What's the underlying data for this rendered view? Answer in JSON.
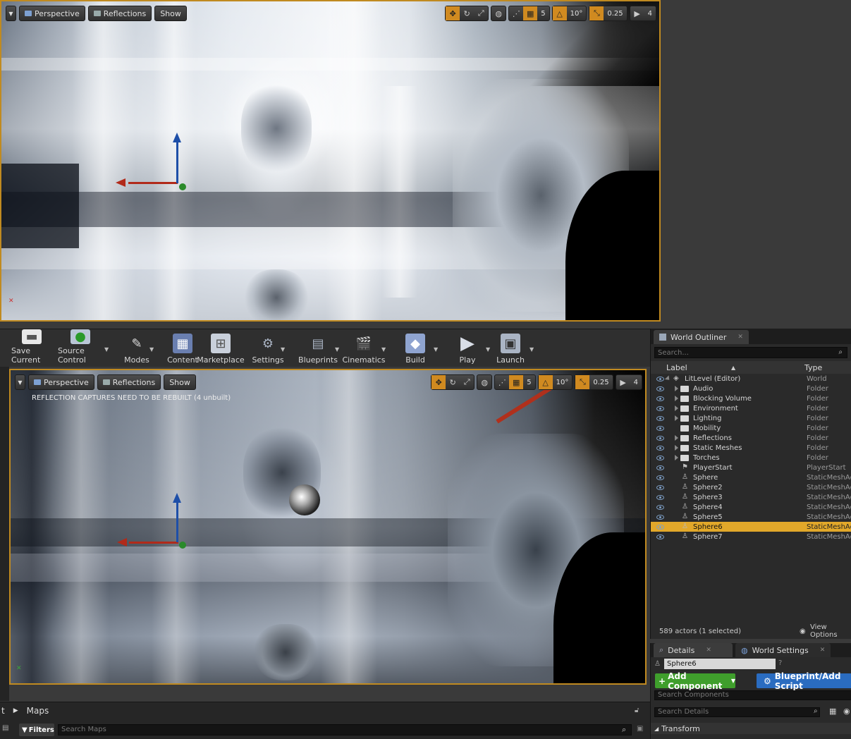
{
  "top_viewport": {
    "mode_label": "Perspective",
    "view_label": "Reflections",
    "show_label": "Show",
    "grid_snap": "5",
    "rotation_snap": "10°",
    "scale_snap": "0.25",
    "camera_speed": "4"
  },
  "toolbar": {
    "items": [
      {
        "label": "Save Current",
        "icon": "save-icon"
      },
      {
        "label": "Source Control",
        "icon": "source-control-icon"
      },
      {
        "label": "Modes",
        "icon": "modes-icon"
      },
      {
        "label": "Content",
        "icon": "content-icon"
      },
      {
        "label": "Marketplace",
        "icon": "marketplace-icon"
      },
      {
        "label": "Settings",
        "icon": "settings-icon"
      },
      {
        "label": "Blueprints",
        "icon": "blueprints-icon"
      },
      {
        "label": "Cinematics",
        "icon": "cinematics-icon"
      },
      {
        "label": "Build",
        "icon": "build-icon"
      },
      {
        "label": "Play",
        "icon": "play-icon"
      },
      {
        "label": "Launch",
        "icon": "launch-icon"
      }
    ]
  },
  "main_viewport": {
    "mode_label": "Perspective",
    "view_label": "Reflections",
    "show_label": "Show",
    "warning": "REFLECTION CAPTURES NEED TO BE REBUILT (4 unbuilt)",
    "grid_snap": "5",
    "rotation_snap": "10°",
    "scale_snap": "0.25",
    "camera_speed": "4"
  },
  "outliner": {
    "tab_title": "World Outliner",
    "search_placeholder": "Search...",
    "col_label": "Label",
    "col_type": "Type",
    "rows": [
      {
        "label": "LitLevel (Editor)",
        "type": "World"
      },
      {
        "label": "Audio",
        "type": "Folder"
      },
      {
        "label": "Blocking Volume",
        "type": "Folder"
      },
      {
        "label": "Environment",
        "type": "Folder"
      },
      {
        "label": "Lighting",
        "type": "Folder"
      },
      {
        "label": "Mobility",
        "type": "Folder"
      },
      {
        "label": "Reflections",
        "type": "Folder"
      },
      {
        "label": "Static Meshes",
        "type": "Folder"
      },
      {
        "label": "Torches",
        "type": "Folder"
      },
      {
        "label": "PlayerStart",
        "type": "PlayerStart"
      },
      {
        "label": "Sphere",
        "type": "StaticMeshActor"
      },
      {
        "label": "Sphere2",
        "type": "StaticMeshActor"
      },
      {
        "label": "Sphere3",
        "type": "StaticMeshActor"
      },
      {
        "label": "Sphere4",
        "type": "StaticMeshActor"
      },
      {
        "label": "Sphere5",
        "type": "StaticMeshActor"
      },
      {
        "label": "Sphere6",
        "type": "StaticMeshActor"
      },
      {
        "label": "Sphere7",
        "type": "StaticMeshActor"
      }
    ],
    "actor_count": "589 actors (1 selected)",
    "view_options": "View Options"
  },
  "details": {
    "tab_details": "Details",
    "tab_world_settings": "World Settings",
    "name_value": "Sphere6",
    "add_component": "Add Component",
    "blueprint_script": "Blueprint/Add Script",
    "search_components": "Search Components",
    "search_details": "Search Details",
    "transform": "Transform"
  },
  "content_browser": {
    "breadcrumb": "Maps",
    "filters": "Filters",
    "search_placeholder": "Search Maps"
  },
  "colors": {
    "selection": "#e2a82a",
    "add_component": "#3f9e2c",
    "blueprint": "#2a6cc0",
    "viewport_border": "#c08a20"
  }
}
